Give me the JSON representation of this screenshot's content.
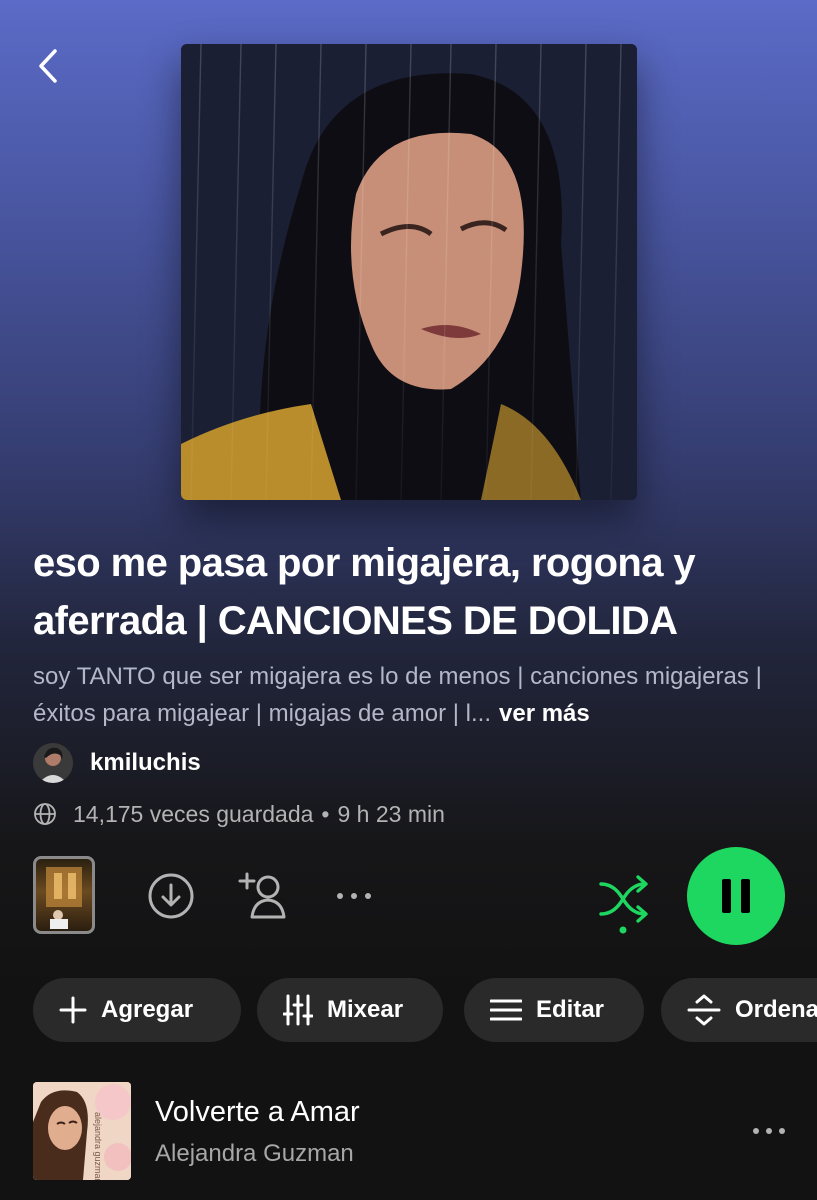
{
  "playlist": {
    "title": "eso me pasa por migajera, rogona y aferrada | CANCIONES DE DOLIDA",
    "description": "soy TANTO que ser migajera es lo de menos | canciones migajeras | éxitos para migajear | migajas de amor | l...",
    "see_more": "ver más",
    "owner": "kmiluchis",
    "saves": "14,175 veces guardada",
    "separator": "•",
    "duration": "9 h 23 min"
  },
  "icons": {
    "back": "chevron-left-icon",
    "globe": "globe-icon",
    "download": "download-icon",
    "add_user": "add-user-icon",
    "more": "more-horizontal-icon",
    "shuffle": "shuffle-icon",
    "pause": "pause-icon"
  },
  "chips": [
    {
      "label": "Agregar",
      "icon": "plus-icon"
    },
    {
      "label": "Mixear",
      "icon": "sliders-icon"
    },
    {
      "label": "Editar",
      "icon": "list-icon"
    },
    {
      "label": "Ordena",
      "icon": "sort-icon"
    }
  ],
  "tracks": [
    {
      "title": "Volverte a Amar",
      "artist": "Alejandra Guzman",
      "album_art_text": "alejandra guzman"
    }
  ],
  "colors": {
    "accent": "#1ed760",
    "background": "#121212",
    "header_gradient_top": "#5b6bc7",
    "chip_bg": "#2a2a2a"
  },
  "player": {
    "state": "playing",
    "shuffle": true
  }
}
